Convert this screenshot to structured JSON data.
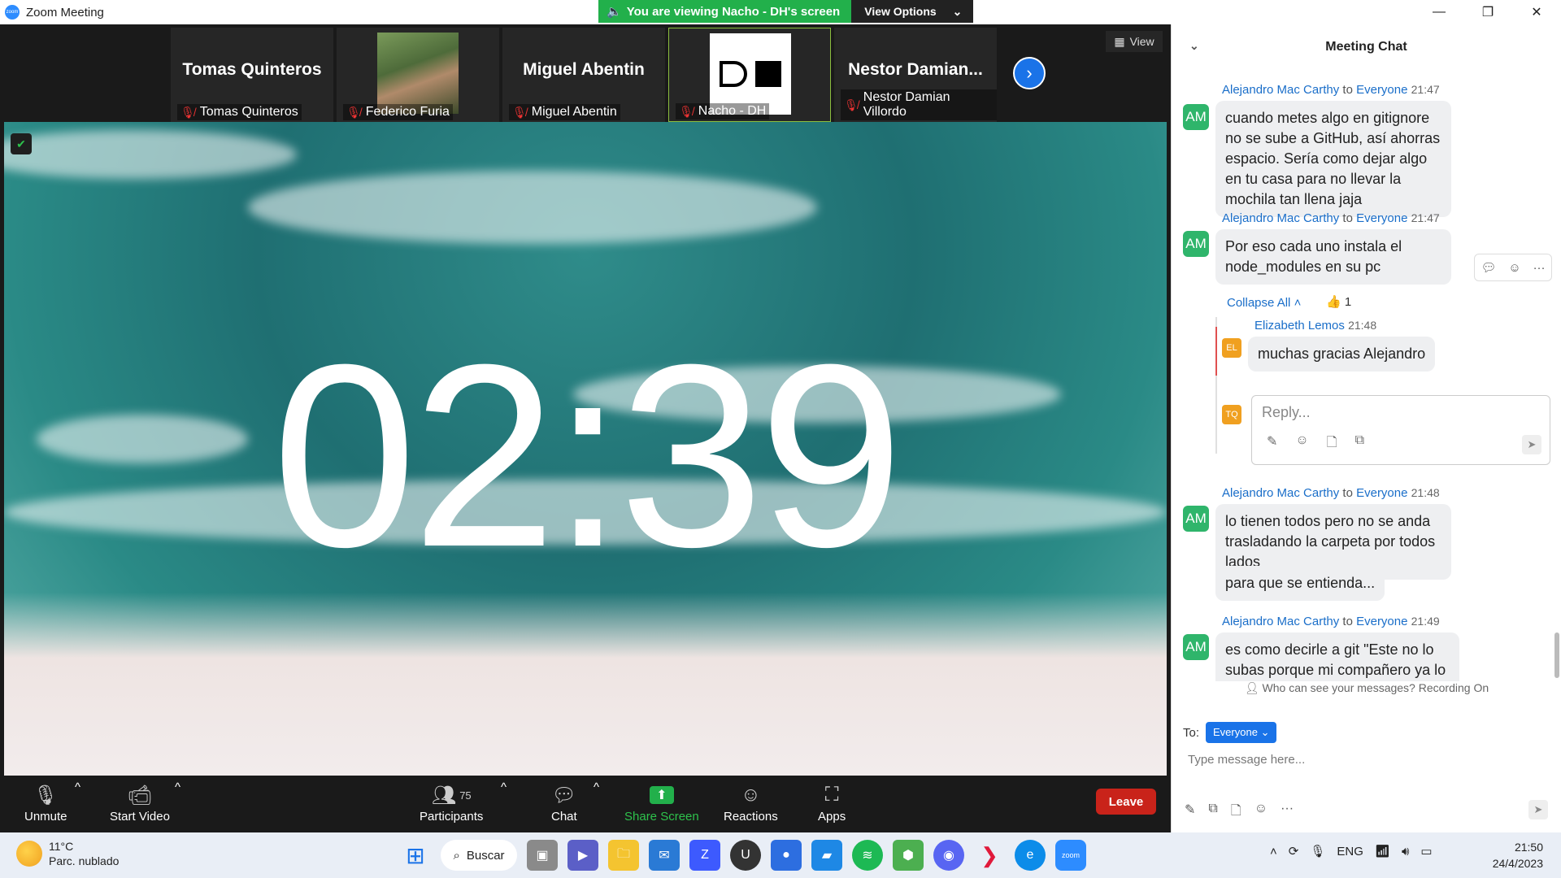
{
  "window": {
    "title": "Zoom Meeting",
    "viewing_text": "You are viewing Nacho - DH's screen",
    "view_options": "View Options",
    "controls": {
      "minimize": "—",
      "restore": "❐",
      "close": "✕"
    }
  },
  "thumbnails": [
    {
      "big_name": "Tomas Quinteros",
      "small_name": "Tomas Quinteros",
      "type": "name"
    },
    {
      "big_name": "",
      "small_name": "Federico Furia",
      "type": "photo"
    },
    {
      "big_name": "Miguel Abentin",
      "small_name": "Miguel Abentin",
      "type": "name"
    },
    {
      "big_name": "",
      "small_name": "Nacho - DH",
      "type": "logo"
    },
    {
      "big_name": "Nestor  Damian...",
      "small_name": "Nestor Damian Villordo",
      "type": "name"
    }
  ],
  "view_button": "View",
  "timer": "02:39",
  "toolbar": {
    "unmute": "Unmute",
    "start_video": "Start Video",
    "participants": "Participants",
    "participants_count": "75",
    "chat": "Chat",
    "share_screen": "Share Screen",
    "reactions": "Reactions",
    "apps": "Apps",
    "leave": "Leave"
  },
  "chat": {
    "title": "Meeting Chat",
    "messages": [
      {
        "avatar": "AM",
        "sender": "Alejandro Mac Carthy",
        "to": "to",
        "recipient": "Everyone",
        "time": "21:47",
        "text": "cuando metes algo en gitignore no se sube a GitHub, así ahorras espacio. Sería como dejar algo en tu casa para no llevar la mochila tan llena jaja"
      },
      {
        "avatar": "AM",
        "sender": "Alejandro Mac Carthy",
        "to": "to",
        "recipient": "Everyone",
        "time": "21:47",
        "text": "Por eso cada uno instala el node_modules en su pc"
      },
      {
        "avatar": "AM",
        "sender": "Alejandro Mac Carthy",
        "to": "to",
        "recipient": "Everyone",
        "time": "21:48",
        "text": "lo tienen todos pero no se anda trasladando la carpeta por todos lados",
        "text2": "para que se entienda..."
      },
      {
        "avatar": "AM",
        "sender": "Alejandro Mac Carthy",
        "to": "to",
        "recipient": "Everyone",
        "time": "21:49",
        "text": "es como decirle a git \"Este no lo subas porque mi compañero ya lo tiene\""
      }
    ],
    "collapse_all": "Collapse All",
    "reaction_count": "1",
    "thread_reply": {
      "avatar": "EL",
      "sender": "Elizabeth Lemos",
      "time": "21:48",
      "text": "muchas gracias Alejandro"
    },
    "reply_avatar": "TQ",
    "reply_placeholder": "Reply...",
    "who_can_see": "Who can see your messages? Recording On",
    "to_label": "To:",
    "to_value": "Everyone",
    "type_placeholder": "Type message here..."
  },
  "taskbar": {
    "temperature": "11°C",
    "weather": "Parc. nublado",
    "search": "Buscar",
    "language": "ENG",
    "time": "21:50",
    "date": "24/4/2023"
  }
}
